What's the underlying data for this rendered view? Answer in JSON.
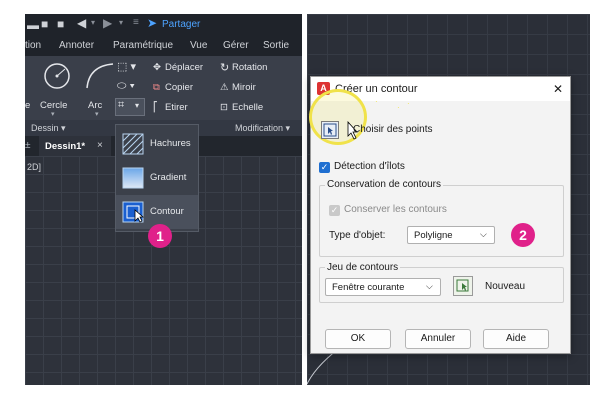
{
  "left": {
    "qat_title": "Partager",
    "menu": [
      "tion",
      "Annoter",
      "Paramétrique",
      "Vue",
      "Gérer",
      "Sortie"
    ],
    "draw_tools": [
      "e",
      "Cercle",
      "Arc"
    ],
    "modify_tools": [
      "Déplacer",
      "Rotation",
      "Copier",
      "Miroir",
      "Etirer",
      "Echelle"
    ],
    "panel_labels": {
      "draw": "Dessin ▾",
      "modify": "Modification ▾"
    },
    "doc_tab": {
      "label": "Dessin1*",
      "close": "×",
      "left_marker": "±"
    },
    "viewport_label": "2D]",
    "dropdown": [
      "Hachures",
      "Gradient",
      "Contour"
    ],
    "step_badge": "1"
  },
  "dialog": {
    "title": "Créer un contour",
    "close": "✕",
    "pick_points": "Choisir des points",
    "island_detection": {
      "label": "Détection d'îlots",
      "checked": true
    },
    "retention_group": "Conservation de contours",
    "retain_boundaries": {
      "label": "Conserver les contours",
      "checked": true
    },
    "object_type_label": "Type d'objet:",
    "object_type_value": "Polyligne",
    "boundary_set_group": "Jeu de contours",
    "boundary_set_value": "Fenêtre courante",
    "new_label": "Nouveau",
    "buttons": {
      "ok": "OK",
      "cancel": "Annuler",
      "help": "Aide"
    },
    "step_badge": "2"
  },
  "colors": {
    "accent_pink": "#e0218a",
    "highlight_yellow": "#f0e24a",
    "checkbox_blue": "#1f6fd1"
  }
}
